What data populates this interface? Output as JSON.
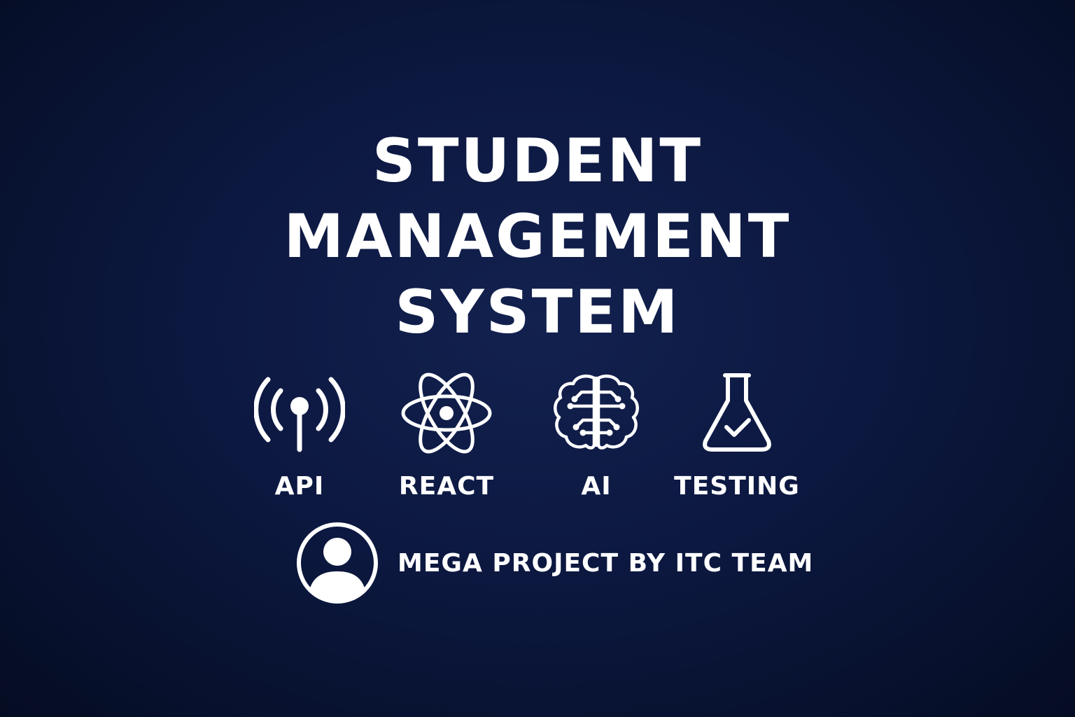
{
  "title": {
    "line1": "STUDENT",
    "line2": "MANAGEMENT",
    "line3": "SYSTEM"
  },
  "tech": [
    {
      "label": "API",
      "icon": "antenna-icon"
    },
    {
      "label": "REACT",
      "icon": "atom-icon"
    },
    {
      "label": "AI",
      "icon": "brain-circuit-icon"
    },
    {
      "label": "TESTING",
      "icon": "flask-check-icon"
    }
  ],
  "team": {
    "text": "MEGA PROJECT BY ITC TEAM",
    "icon": "user-avatar-icon"
  },
  "colors": {
    "background": "#0c1840",
    "foreground": "#ffffff"
  }
}
